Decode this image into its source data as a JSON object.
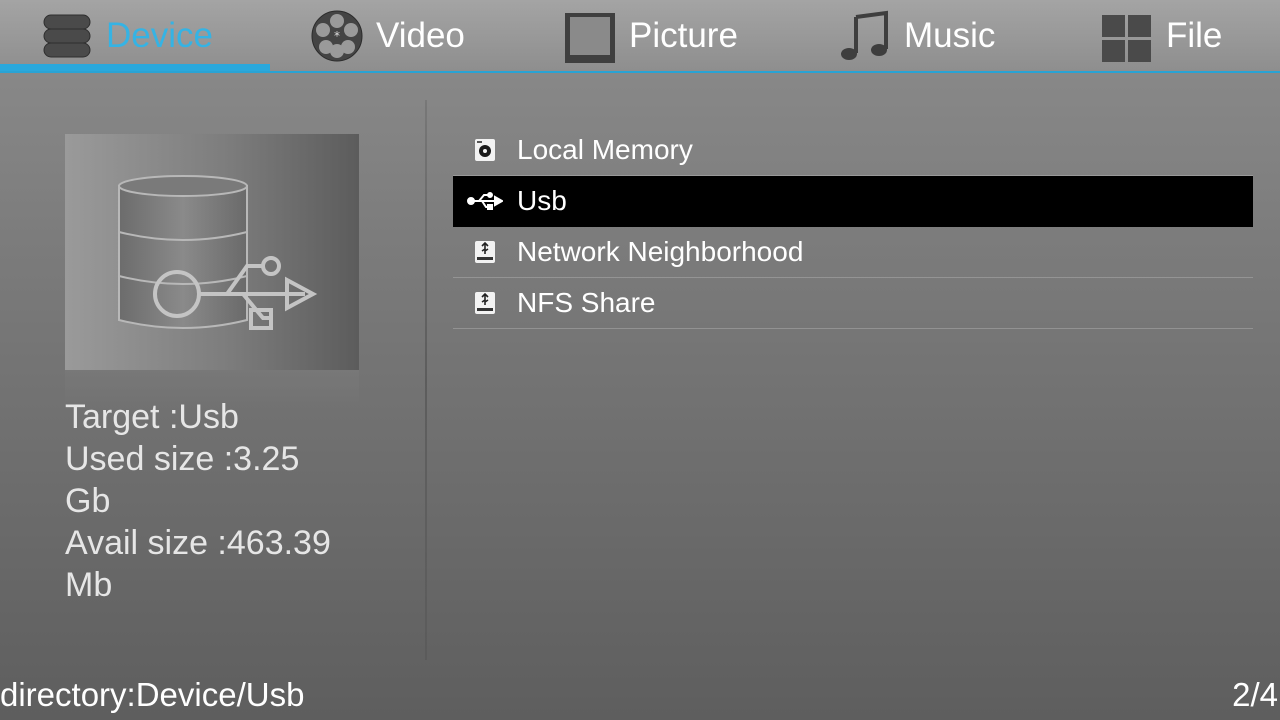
{
  "tabs": [
    {
      "label": "Device",
      "icon": "database-icon",
      "active": true
    },
    {
      "label": "Video",
      "icon": "film-reel-icon",
      "active": false
    },
    {
      "label": "Picture",
      "icon": "picture-frame-icon",
      "active": false
    },
    {
      "label": "Music",
      "icon": "music-note-icon",
      "active": false
    },
    {
      "label": "File",
      "icon": "grid-icon",
      "active": false
    }
  ],
  "preview": {
    "icon": "database-usb-icon"
  },
  "info": {
    "target": "Target :Usb",
    "used_size": "Used size :3.25",
    "used_unit": "Gb",
    "avail_size": "Avail size :463.39",
    "avail_unit": "Mb"
  },
  "devices": [
    {
      "label": "Local Memory",
      "icon": "hard-disk-icon",
      "selected": false
    },
    {
      "label": "Usb",
      "icon": "usb-icon",
      "selected": true
    },
    {
      "label": "Network Neighborhood",
      "icon": "network-drive-icon",
      "selected": false
    },
    {
      "label": "NFS Share",
      "icon": "network-drive-icon",
      "selected": false
    }
  ],
  "footer": {
    "directory": "directory:Device/Usb",
    "page": "2/4"
  },
  "colors": {
    "accent": "#2aa8dc",
    "active_tab_text": "#35b3e4",
    "selected_row": "#000000"
  }
}
